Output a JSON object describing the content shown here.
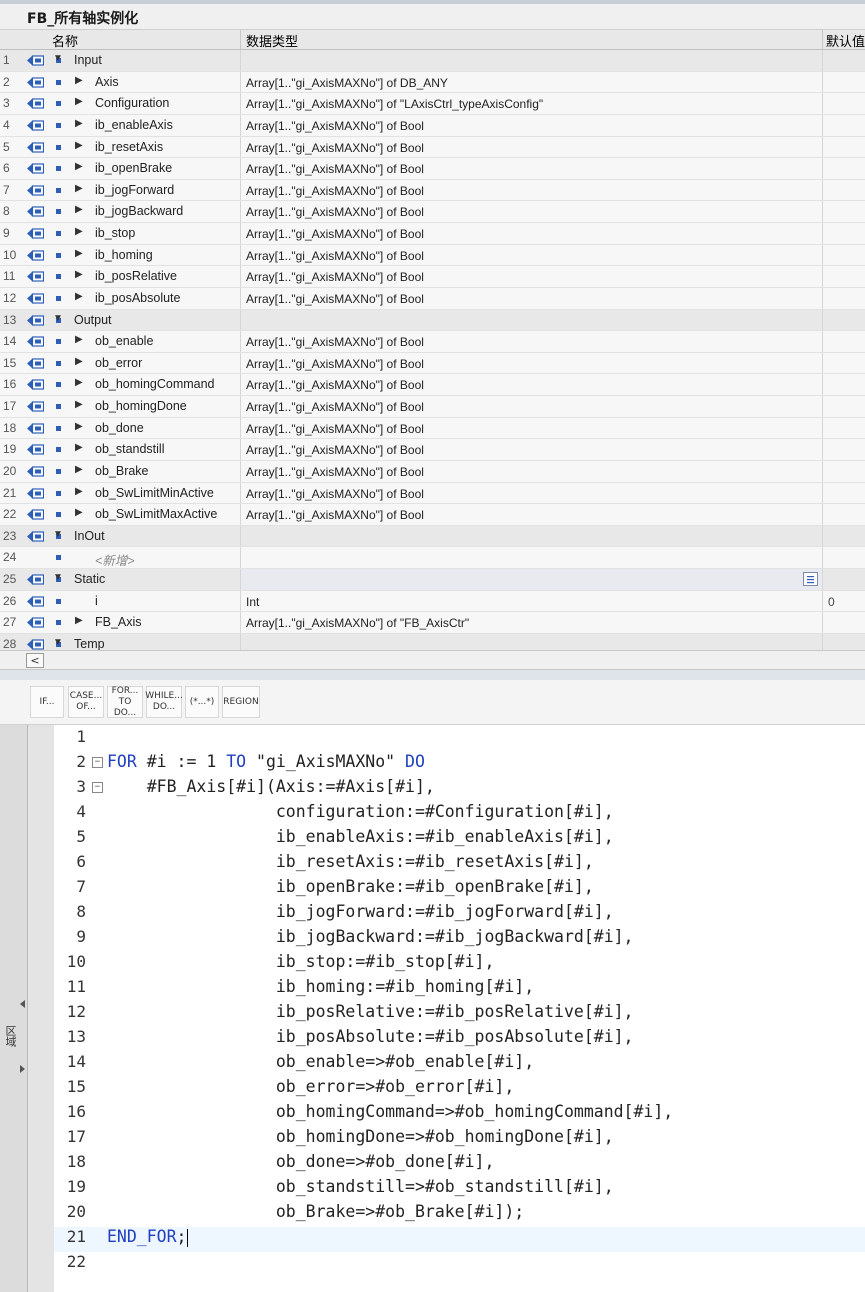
{
  "window": {
    "title": "FB_所有轴实例化"
  },
  "table": {
    "headers": {
      "name": "名称",
      "type": "数据类型",
      "default": "默认值"
    },
    "rows": [
      {
        "num": "1",
        "kind": "section",
        "name": "Input",
        "type": "",
        "default": ""
      },
      {
        "num": "2",
        "kind": "item",
        "name": "Axis",
        "type": "Array[1..\"gi_AxisMAXNo\"] of DB_ANY",
        "default": ""
      },
      {
        "num": "3",
        "kind": "item",
        "name": "Configuration",
        "type": "Array[1..\"gi_AxisMAXNo\"] of \"LAxisCtrl_typeAxisConfig\"",
        "default": ""
      },
      {
        "num": "4",
        "kind": "item",
        "name": "ib_enableAxis",
        "type": "Array[1..\"gi_AxisMAXNo\"] of Bool",
        "default": ""
      },
      {
        "num": "5",
        "kind": "item",
        "name": "ib_resetAxis",
        "type": "Array[1..\"gi_AxisMAXNo\"] of Bool",
        "default": ""
      },
      {
        "num": "6",
        "kind": "item",
        "name": "ib_openBrake",
        "type": "Array[1..\"gi_AxisMAXNo\"] of Bool",
        "default": ""
      },
      {
        "num": "7",
        "kind": "item",
        "name": "ib_jogForward",
        "type": "Array[1..\"gi_AxisMAXNo\"] of Bool",
        "default": ""
      },
      {
        "num": "8",
        "kind": "item",
        "name": "ib_jogBackward",
        "type": "Array[1..\"gi_AxisMAXNo\"] of Bool",
        "default": ""
      },
      {
        "num": "9",
        "kind": "item",
        "name": "ib_stop",
        "type": "Array[1..\"gi_AxisMAXNo\"] of Bool",
        "default": ""
      },
      {
        "num": "10",
        "kind": "item",
        "name": "ib_homing",
        "type": "Array[1..\"gi_AxisMAXNo\"] of Bool",
        "default": ""
      },
      {
        "num": "11",
        "kind": "item",
        "name": "ib_posRelative",
        "type": "Array[1..\"gi_AxisMAXNo\"] of Bool",
        "default": ""
      },
      {
        "num": "12",
        "kind": "item",
        "name": "ib_posAbsolute",
        "type": "Array[1..\"gi_AxisMAXNo\"] of Bool",
        "default": ""
      },
      {
        "num": "13",
        "kind": "section",
        "name": "Output",
        "type": "",
        "default": ""
      },
      {
        "num": "14",
        "kind": "item",
        "name": "ob_enable",
        "type": "Array[1..\"gi_AxisMAXNo\"] of Bool",
        "default": ""
      },
      {
        "num": "15",
        "kind": "item",
        "name": "ob_error",
        "type": "Array[1..\"gi_AxisMAXNo\"] of Bool",
        "default": ""
      },
      {
        "num": "16",
        "kind": "item",
        "name": "ob_homingCommand",
        "type": "Array[1..\"gi_AxisMAXNo\"] of Bool",
        "default": ""
      },
      {
        "num": "17",
        "kind": "item",
        "name": "ob_homingDone",
        "type": "Array[1..\"gi_AxisMAXNo\"] of Bool",
        "default": ""
      },
      {
        "num": "18",
        "kind": "item",
        "name": "ob_done",
        "type": "Array[1..\"gi_AxisMAXNo\"] of Bool",
        "default": ""
      },
      {
        "num": "19",
        "kind": "item",
        "name": "ob_standstill",
        "type": "Array[1..\"gi_AxisMAXNo\"] of Bool",
        "default": ""
      },
      {
        "num": "20",
        "kind": "item",
        "name": "ob_Brake",
        "type": "Array[1..\"gi_AxisMAXNo\"] of Bool",
        "default": ""
      },
      {
        "num": "21",
        "kind": "item",
        "name": "ob_SwLimitMinActive",
        "type": "Array[1..\"gi_AxisMAXNo\"] of Bool",
        "default": ""
      },
      {
        "num": "22",
        "kind": "item",
        "name": "ob_SwLimitMaxActive",
        "type": "Array[1..\"gi_AxisMAXNo\"] of Bool",
        "default": ""
      },
      {
        "num": "23",
        "kind": "section",
        "name": "InOut",
        "type": "",
        "default": ""
      },
      {
        "num": "24",
        "kind": "placeholder",
        "name": "<新增>",
        "type": "",
        "default": ""
      },
      {
        "num": "25",
        "kind": "section-static",
        "name": "Static",
        "type": "",
        "default": ""
      },
      {
        "num": "26",
        "kind": "leaf",
        "name": "i",
        "type": "Int",
        "default": "0"
      },
      {
        "num": "27",
        "kind": "item",
        "name": "FB_Axis",
        "type": "Array[1..\"gi_AxisMAXNo\"] of \"FB_AxisCtr\"",
        "default": ""
      },
      {
        "num": "28",
        "kind": "section",
        "name": "Temp",
        "type": "",
        "default": ""
      }
    ]
  },
  "toolbar": {
    "buttons": [
      {
        "label": "IF...",
        "name": "insert-if-button"
      },
      {
        "label": "CASE... OF...",
        "name": "insert-case-button"
      },
      {
        "label": "FOR... TO DO...",
        "name": "insert-for-button"
      },
      {
        "label": "WHILE... DO...",
        "name": "insert-while-button"
      },
      {
        "label": "(*...*)",
        "name": "insert-comment-button"
      },
      {
        "label": "REGION",
        "name": "insert-region-button"
      }
    ]
  },
  "sidebar": {
    "label": "区域"
  },
  "code": {
    "lines": [
      {
        "n": "1",
        "fold": "",
        "text": ""
      },
      {
        "n": "2",
        "fold": "⊟",
        "text": "FOR #i := 1 TO \"gi_AxisMAXNo\" DO"
      },
      {
        "n": "3",
        "fold": "⊟",
        "text": "    #FB_Axis[#i](Axis:=#Axis[#i],"
      },
      {
        "n": "4",
        "fold": "",
        "text": "                 configuration:=#Configuration[#i],"
      },
      {
        "n": "5",
        "fold": "",
        "text": "                 ib_enableAxis:=#ib_enableAxis[#i],"
      },
      {
        "n": "6",
        "fold": "",
        "text": "                 ib_resetAxis:=#ib_resetAxis[#i],"
      },
      {
        "n": "7",
        "fold": "",
        "text": "                 ib_openBrake:=#ib_openBrake[#i],"
      },
      {
        "n": "8",
        "fold": "",
        "text": "                 ib_jogForward:=#ib_jogForward[#i],"
      },
      {
        "n": "9",
        "fold": "",
        "text": "                 ib_jogBackward:=#ib_jogBackward[#i],"
      },
      {
        "n": "10",
        "fold": "",
        "text": "                 ib_stop:=#ib_stop[#i],"
      },
      {
        "n": "11",
        "fold": "",
        "text": "                 ib_homing:=#ib_homing[#i],"
      },
      {
        "n": "12",
        "fold": "",
        "text": "                 ib_posRelative:=#ib_posRelative[#i],"
      },
      {
        "n": "13",
        "fold": "",
        "text": "                 ib_posAbsolute:=#ib_posAbsolute[#i],"
      },
      {
        "n": "14",
        "fold": "",
        "text": "                 ob_enable=>#ob_enable[#i],"
      },
      {
        "n": "15",
        "fold": "",
        "text": "                 ob_error=>#ob_error[#i],"
      },
      {
        "n": "16",
        "fold": "",
        "text": "                 ob_homingCommand=>#ob_homingCommand[#i],"
      },
      {
        "n": "17",
        "fold": "",
        "text": "                 ob_homingDone=>#ob_homingDone[#i],"
      },
      {
        "n": "18",
        "fold": "",
        "text": "                 ob_done=>#ob_done[#i],"
      },
      {
        "n": "19",
        "fold": "",
        "text": "                 ob_standstill=>#ob_standstill[#i],"
      },
      {
        "n": "20",
        "fold": "",
        "text": "                 ob_Brake=>#ob_Brake[#i]);"
      },
      {
        "n": "21",
        "fold": "",
        "text": "END_FOR;"
      },
      {
        "n": "22",
        "fold": "",
        "text": ""
      }
    ],
    "active_line": "21"
  },
  "colors": {
    "keyword": "#1f3fc0",
    "interface_icon": "#2d5fb8",
    "section_bg": "#e8e8e8",
    "active_line_bg": "#eef6ff"
  }
}
